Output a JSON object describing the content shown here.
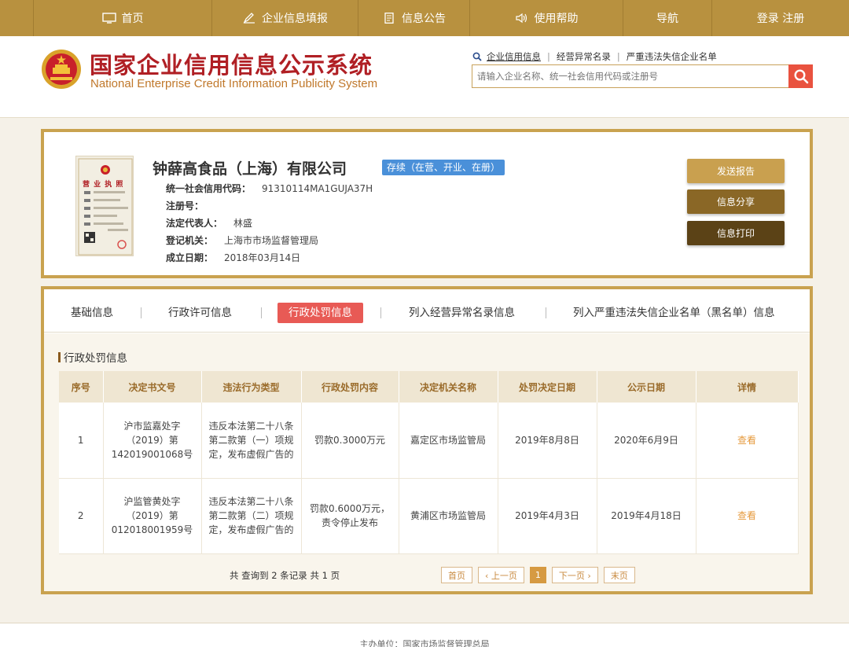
{
  "topnav": {
    "items": [
      {
        "label": "首页",
        "icon": "monitor-icon"
      },
      {
        "label": "企业信息填报",
        "icon": "pen-icon"
      },
      {
        "label": "信息公告",
        "icon": "document-icon"
      },
      {
        "label": "使用帮助",
        "icon": "speaker-icon"
      },
      {
        "label": "导航",
        "icon": ""
      },
      {
        "label": "登录 注册",
        "icon": ""
      }
    ]
  },
  "header": {
    "title_cn": "国家企业信用信息公示系统",
    "title_en": "National Enterprise Credit Information Publicity System",
    "search_links": [
      "企业信用信息",
      "经营异常名录",
      "严重违法失信企业名单"
    ],
    "search_placeholder": "请输入企业名称、统一社会信用代码或注册号"
  },
  "company": {
    "license_title": "营 业 执 照",
    "name": "钟薛高食品（上海）有限公司",
    "status": "存续（在营、开业、在册）",
    "fields": [
      {
        "label": "统一社会信用代码：",
        "value": "91310114MA1GUJA37H"
      },
      {
        "label": "注册号：",
        "value": ""
      },
      {
        "label": "法定代表人：",
        "value": "林盛"
      },
      {
        "label": "登记机关：",
        "value": "上海市市场监督管理局"
      },
      {
        "label": "成立日期：",
        "value": "2018年03月14日"
      }
    ],
    "buttons": {
      "send": "发送报告",
      "share": "信息分享",
      "print": "信息打印"
    }
  },
  "tabs": {
    "items": [
      "基础信息",
      "行政许可信息",
      "行政处罚信息",
      "列入经营异常名录信息",
      "列入严重违法失信企业名单（黑名单）信息"
    ],
    "active_index": 2
  },
  "section": {
    "title": "行政处罚信息"
  },
  "table": {
    "headers": [
      "序号",
      "决定书文号",
      "违法行为类型",
      "行政处罚内容",
      "决定机关名称",
      "处罚决定日期",
      "公示日期",
      "详情"
    ],
    "rows": [
      [
        "1",
        "沪市监嘉处字（2019）第142019001068号",
        "违反本法第二十八条第二款第（一）项规定，发布虚假广告的",
        "罚款0.3000万元",
        "嘉定区市场监管局",
        "2019年8月8日",
        "2020年6月9日",
        "查看"
      ],
      [
        "2",
        "沪监管黄处字（2019）第012018001959号",
        "违反本法第二十八条第二款第（二）项规定，发布虚假广告的",
        "罚款0.6000万元，责令停止发布",
        "黄浦区市场监管局",
        "2019年4月3日",
        "2019年4月18日",
        "查看"
      ]
    ]
  },
  "pager": {
    "info": "共 查询到 2 条记录 共 1 页",
    "first": "首页",
    "prev": "‹ 上一页",
    "current": "1",
    "next": "下一页 ›",
    "last": "末页"
  },
  "footer": {
    "text": "主办单位：国家市场监督管理总局"
  }
}
